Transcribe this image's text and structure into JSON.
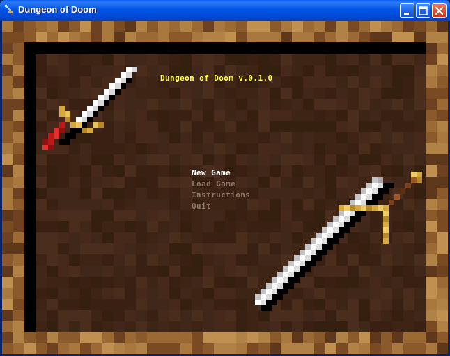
{
  "window": {
    "title": "Dungeon of Doom",
    "buttons": {
      "minimize": "minimize",
      "maximize": "maximize",
      "close": "close"
    }
  },
  "game": {
    "title": "Dungeon of Doom v.0.1.0",
    "menu": [
      {
        "label": "New Game",
        "selected": true
      },
      {
        "label": "Load Game",
        "selected": false
      },
      {
        "label": "Instructions",
        "selected": false
      },
      {
        "label": "Quit",
        "selected": false
      }
    ]
  },
  "colors": {
    "title_text": "#ffff3c",
    "menu_selected": "#ffffff",
    "menu_normal": "#8c7766",
    "board": "#3e2415",
    "frame_wood": "#8a5a2a"
  },
  "icons": [
    "sword-icon",
    "minimize-icon",
    "maximize-icon",
    "close-icon"
  ]
}
